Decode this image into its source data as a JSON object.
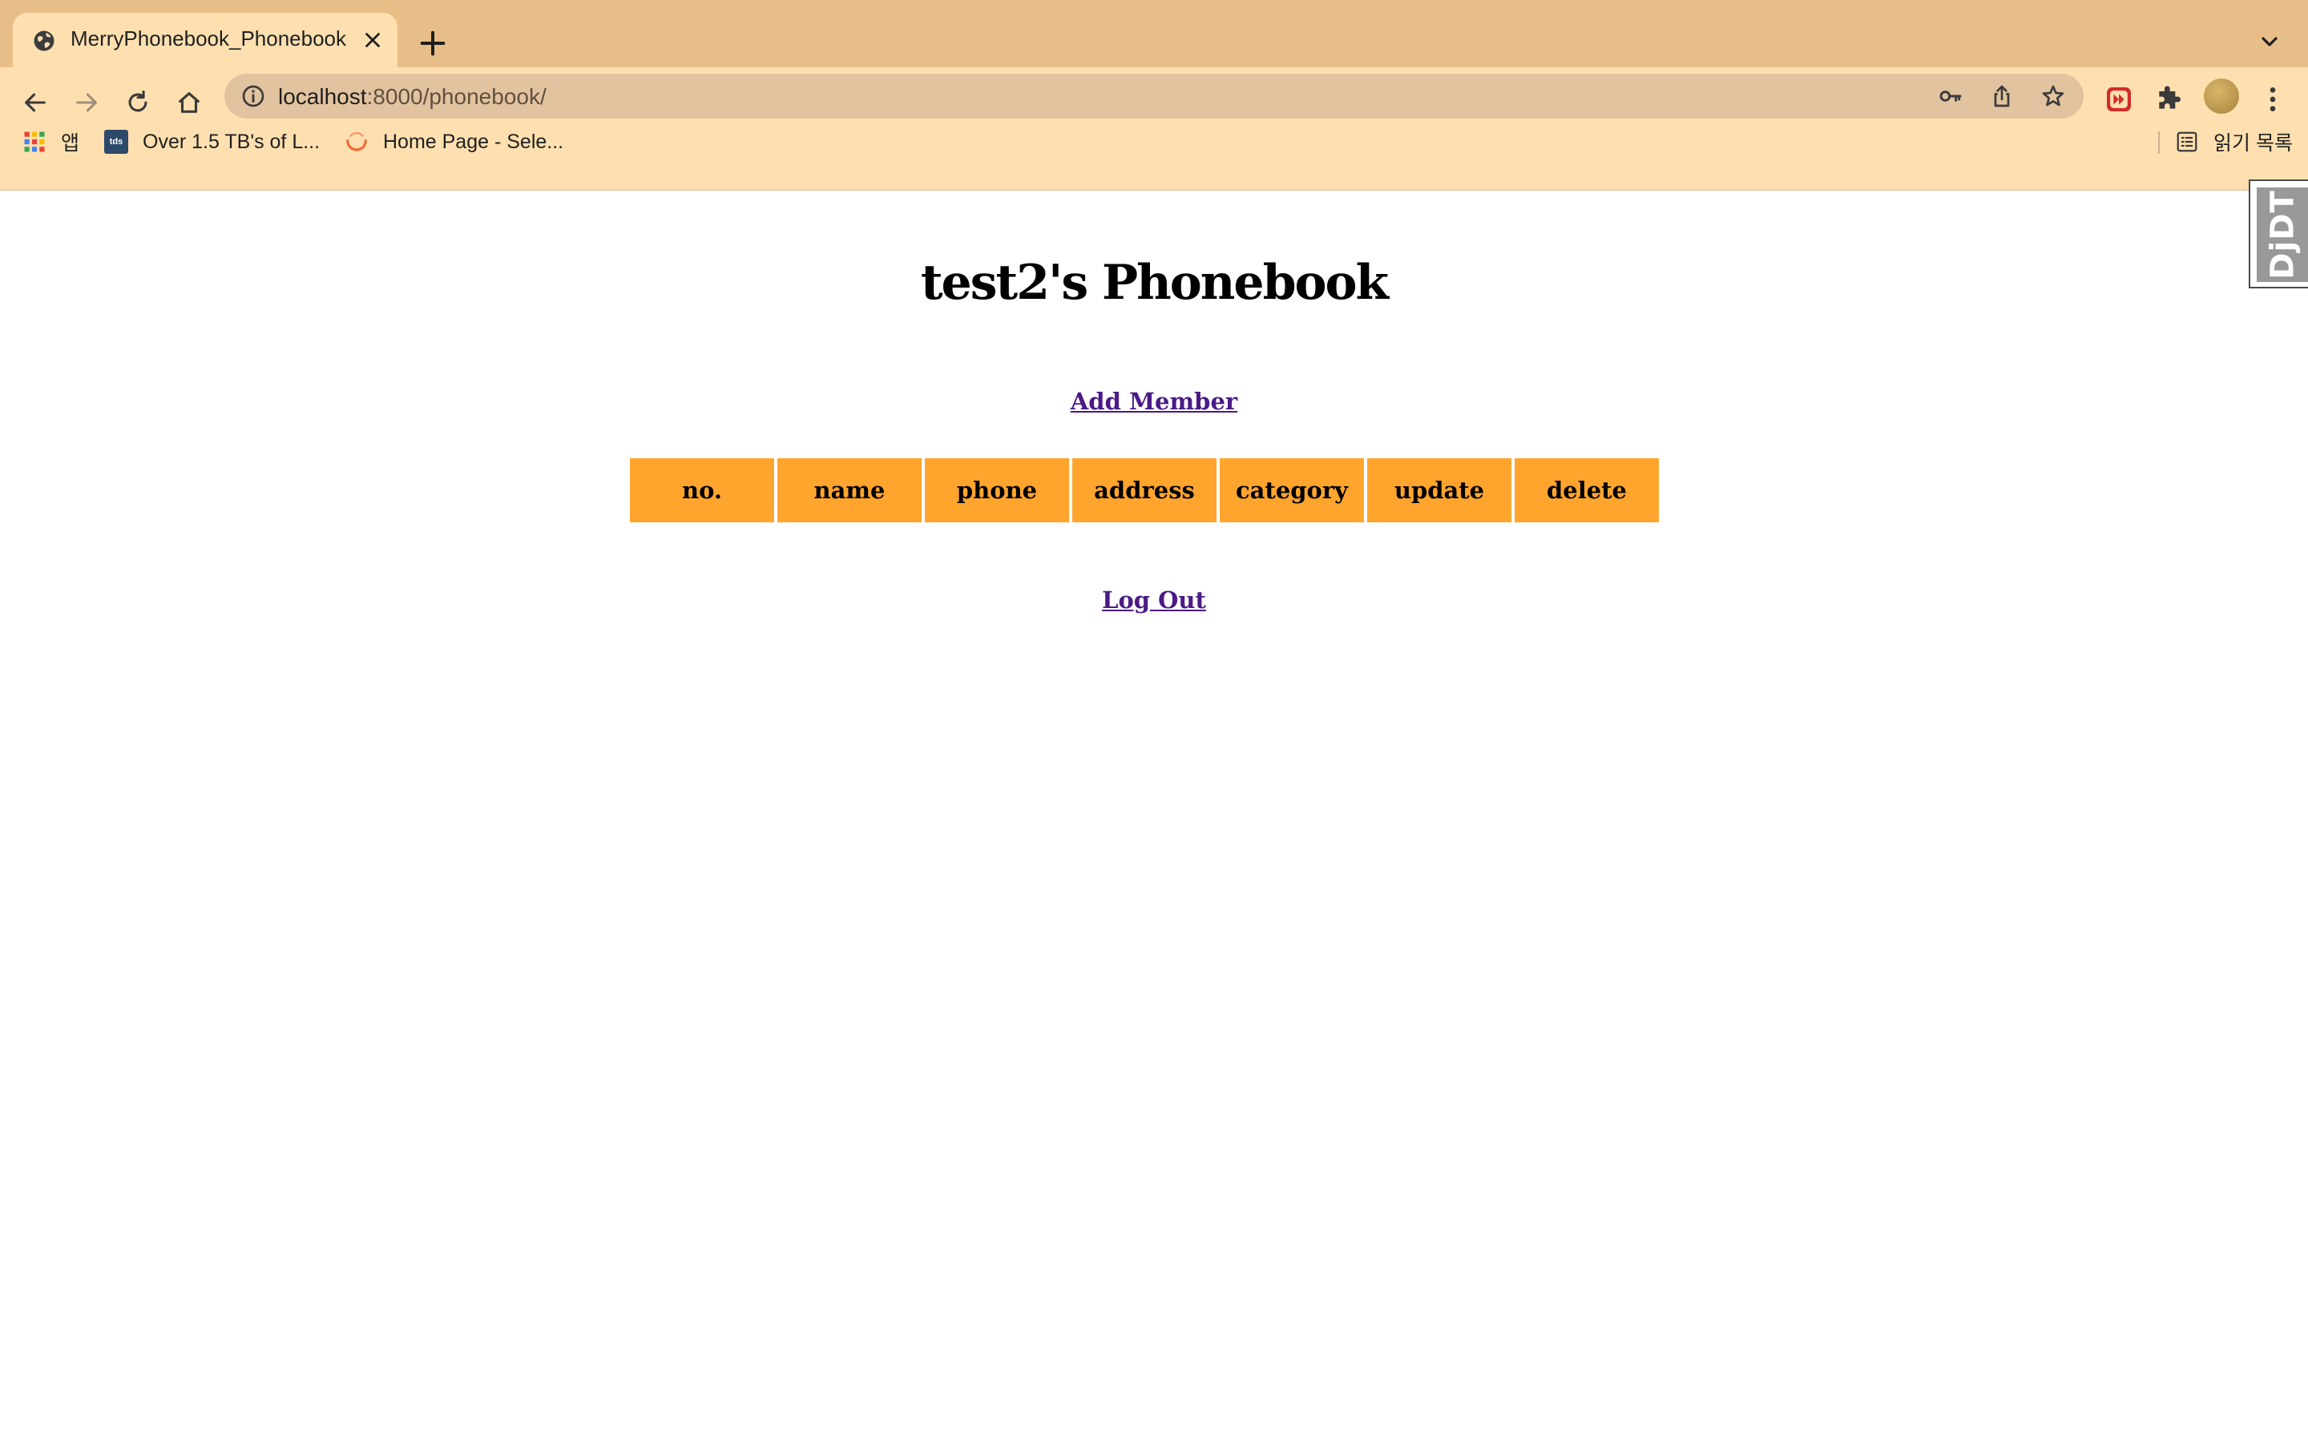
{
  "browser": {
    "tab_title": "MerryPhonebook_Phonebook",
    "url_host": "localhost",
    "url_rest": ":8000/phonebook/",
    "bookmarks": [
      {
        "label": "앱",
        "icon": "apps-grid-icon"
      },
      {
        "label": "Over 1.5 TB's of L...",
        "icon": "tds-icon"
      },
      {
        "label": "Home Page - Sele...",
        "icon": "spinner-icon"
      }
    ],
    "reading_list_label": "읽기 목록"
  },
  "page": {
    "title": "test2's Phonebook",
    "add_member_label": "Add Member",
    "logout_label": "Log Out",
    "table_headers": [
      "no.",
      "name",
      "phone",
      "address",
      "category",
      "update",
      "delete"
    ]
  },
  "toolbar_badge": {
    "label": "DjDT"
  },
  "colors": {
    "chrome_tabstrip": "#e8be88",
    "chrome_toolbar": "#fee0b0",
    "table_header": "#ffa52e",
    "link": "#4b1a86"
  }
}
